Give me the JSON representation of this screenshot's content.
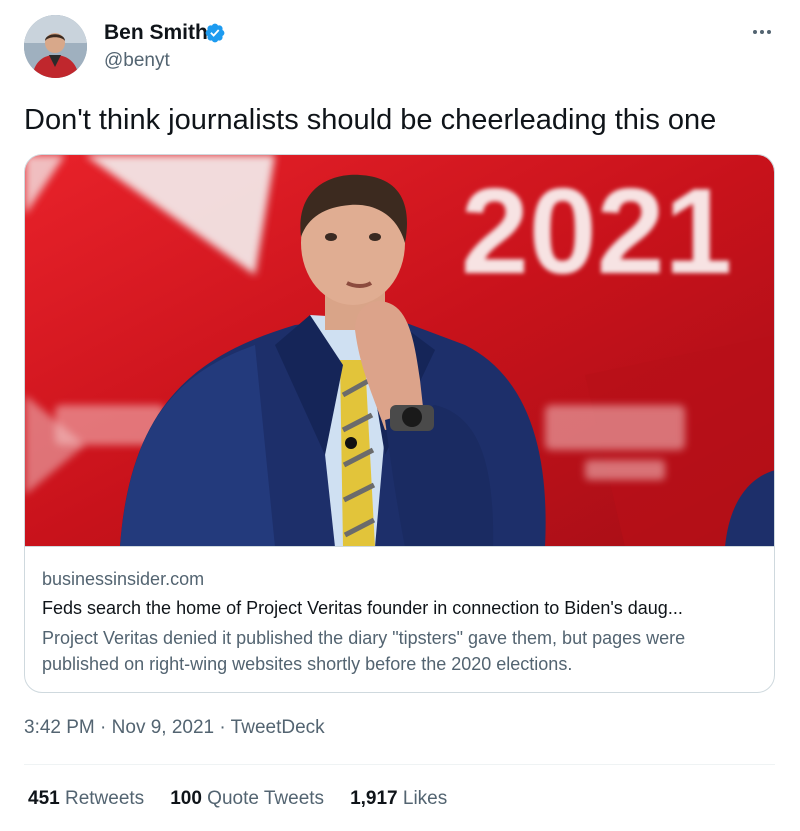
{
  "author": {
    "name": "Ben Smith",
    "handle": "@benyt",
    "verified": true,
    "avatar_icon": "avatar-photo"
  },
  "tweet": {
    "text": "Don't think journalists should be cheerleading this one"
  },
  "card": {
    "image_text": "2021",
    "domain": "businessinsider.com",
    "title": "Feds search the home of Project Veritas founder in connection to Biden's daug...",
    "description": "Project Veritas denied it published the diary \"tipsters\" gave them, but pages were published on right-wing websites shortly before the 2020 elections."
  },
  "meta": {
    "time": "3:42 PM",
    "sep1": " · ",
    "date": "Nov 9, 2021",
    "sep2": " · ",
    "source": "TweetDeck"
  },
  "stats": {
    "retweets_count": "451",
    "retweets_label": "Retweets",
    "quotes_count": "100",
    "quotes_label": "Quote Tweets",
    "likes_count": "1,917",
    "likes_label": "Likes"
  },
  "colors": {
    "text": "#0f1419",
    "secondary": "#536471",
    "verified": "#1d9bf0",
    "border": "#cfd9de",
    "image_red": "#d3141e"
  }
}
